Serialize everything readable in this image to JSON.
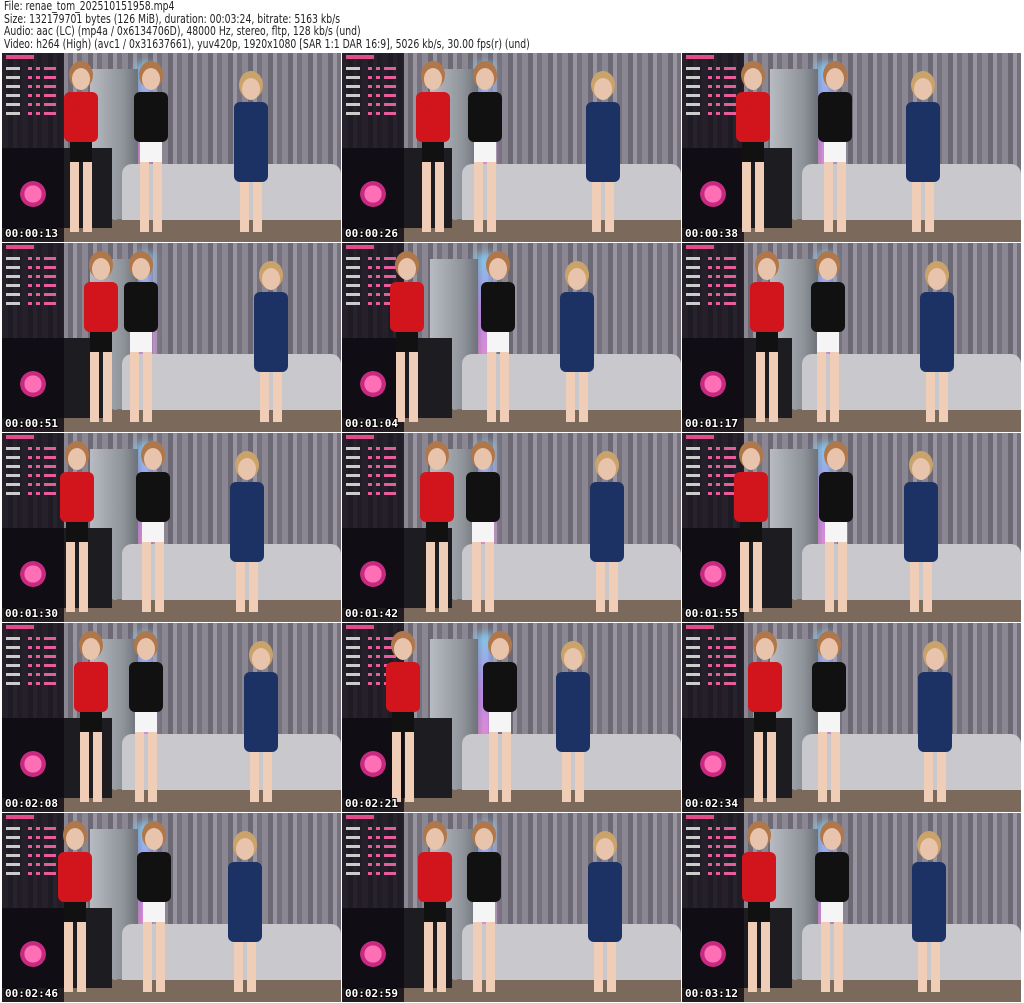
{
  "header": {
    "file": "File: renae_tom_202510151958.mp4",
    "size": "Size: 132179701 bytes (126 MiB), duration: 00:03:24, bitrate: 5163 kb/s",
    "audio": "Audio: aac (LC) (mp4a / 0x6134706D), 48000 Hz, stereo, fltp, 128 kb/s (und)",
    "video": "Video: h264 (High) (avc1 / 0x31637661), yuv420p, 1920x1080 [SAR 1:1 DAR 16:9], 5026 kb/s, 30.00 fps(r) (und)"
  },
  "thumbnails": [
    {
      "timestamp": "00:00:13"
    },
    {
      "timestamp": "00:00:26"
    },
    {
      "timestamp": "00:00:38"
    },
    {
      "timestamp": "00:00:51"
    },
    {
      "timestamp": "00:01:04"
    },
    {
      "timestamp": "00:01:17"
    },
    {
      "timestamp": "00:01:30"
    },
    {
      "timestamp": "00:01:42"
    },
    {
      "timestamp": "00:01:55"
    },
    {
      "timestamp": "00:02:08"
    },
    {
      "timestamp": "00:02:21"
    },
    {
      "timestamp": "00:02:34"
    },
    {
      "timestamp": "00:02:46"
    },
    {
      "timestamp": "00:02:59"
    },
    {
      "timestamp": "00:03:12"
    }
  ]
}
